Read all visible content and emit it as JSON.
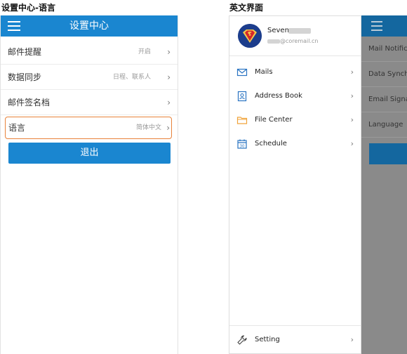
{
  "captions": {
    "left": "设置中心-语言",
    "right": "英文界面"
  },
  "settings_screen": {
    "title": "设置中心",
    "rows": [
      {
        "label": "邮件提醒",
        "value": "开启"
      },
      {
        "label": "数据同步",
        "value": "日程、联系人"
      },
      {
        "label": "邮件签名档",
        "value": ""
      },
      {
        "label": "语言",
        "value": "简体中文"
      }
    ],
    "logout_label": "退出",
    "colors": {
      "brand": "#1a86d0",
      "highlight_border": "#e8823a"
    }
  },
  "drawer_screen": {
    "profile": {
      "name": "Seven",
      "email": "@coremail.cn"
    },
    "menu": [
      {
        "label": "Mails",
        "icon": "mail-icon"
      },
      {
        "label": "Address Book",
        "icon": "address-book-icon"
      },
      {
        "label": "File Center",
        "icon": "folder-icon"
      },
      {
        "label": "Schedule",
        "icon": "calendar-icon"
      }
    ],
    "setting_label": "Setting",
    "underlay_rows": [
      "Mail Notific",
      "Data Synch",
      "Email Signa",
      "Language"
    ]
  },
  "icons": {
    "chevron": "›"
  }
}
